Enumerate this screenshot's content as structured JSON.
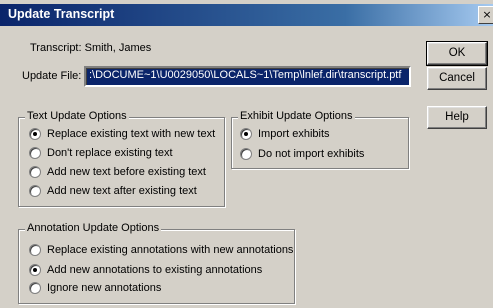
{
  "window": {
    "title": "Update Transcript",
    "close_glyph": "×"
  },
  "transcript_label": "Transcript: Smith, James",
  "update_file": {
    "label": "Update File:",
    "value": ":\\DOCUME~1\\U0029050\\LOCALS~1\\Temp\\lnlef.dir\\transcript.ptf"
  },
  "buttons": {
    "ok": "OK",
    "cancel": "Cancel",
    "help": "Help"
  },
  "text_update": {
    "legend": "Text Update Options",
    "options": [
      {
        "label": "Replace existing text with new text",
        "selected": true
      },
      {
        "label": "Don't replace existing text",
        "selected": false
      },
      {
        "label": "Add new text before existing text",
        "selected": false
      },
      {
        "label": "Add new text after existing text",
        "selected": false
      }
    ]
  },
  "exhibit_update": {
    "legend": "Exhibit Update Options",
    "options": [
      {
        "label": "Import exhibits",
        "selected": true
      },
      {
        "label": "Do not import exhibits",
        "selected": false
      }
    ]
  },
  "annotation_update": {
    "legend": "Annotation Update Options",
    "options": [
      {
        "label": "Replace existing annotations with new annotations",
        "selected": false
      },
      {
        "label": "Add new annotations to existing annotations",
        "selected": true
      },
      {
        "label": "Ignore new annotations",
        "selected": false
      }
    ]
  }
}
